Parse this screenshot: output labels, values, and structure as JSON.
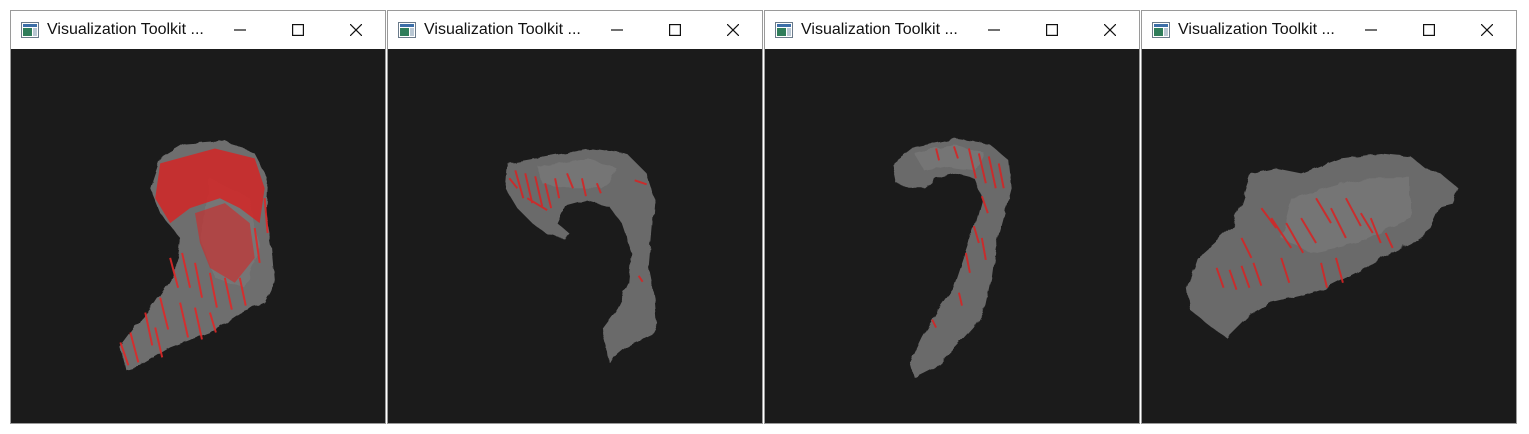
{
  "windows": [
    {
      "title": "Visualization Toolkit ...",
      "view": "oblique-anterior"
    },
    {
      "title": "Visualization Toolkit ...",
      "view": "lateral-left"
    },
    {
      "title": "Visualization Toolkit ...",
      "view": "lateral-right"
    },
    {
      "title": "Visualization Toolkit ...",
      "view": "superior"
    }
  ],
  "icons": {
    "app": "vtk-app-icon",
    "minimize": "minimize-icon",
    "maximize": "maximize-icon",
    "close": "close-icon"
  },
  "colors": {
    "background": "#1b1b1b",
    "surface": "#6e6e6e",
    "highlight": "#d42626",
    "titlebar": "#ffffff"
  }
}
